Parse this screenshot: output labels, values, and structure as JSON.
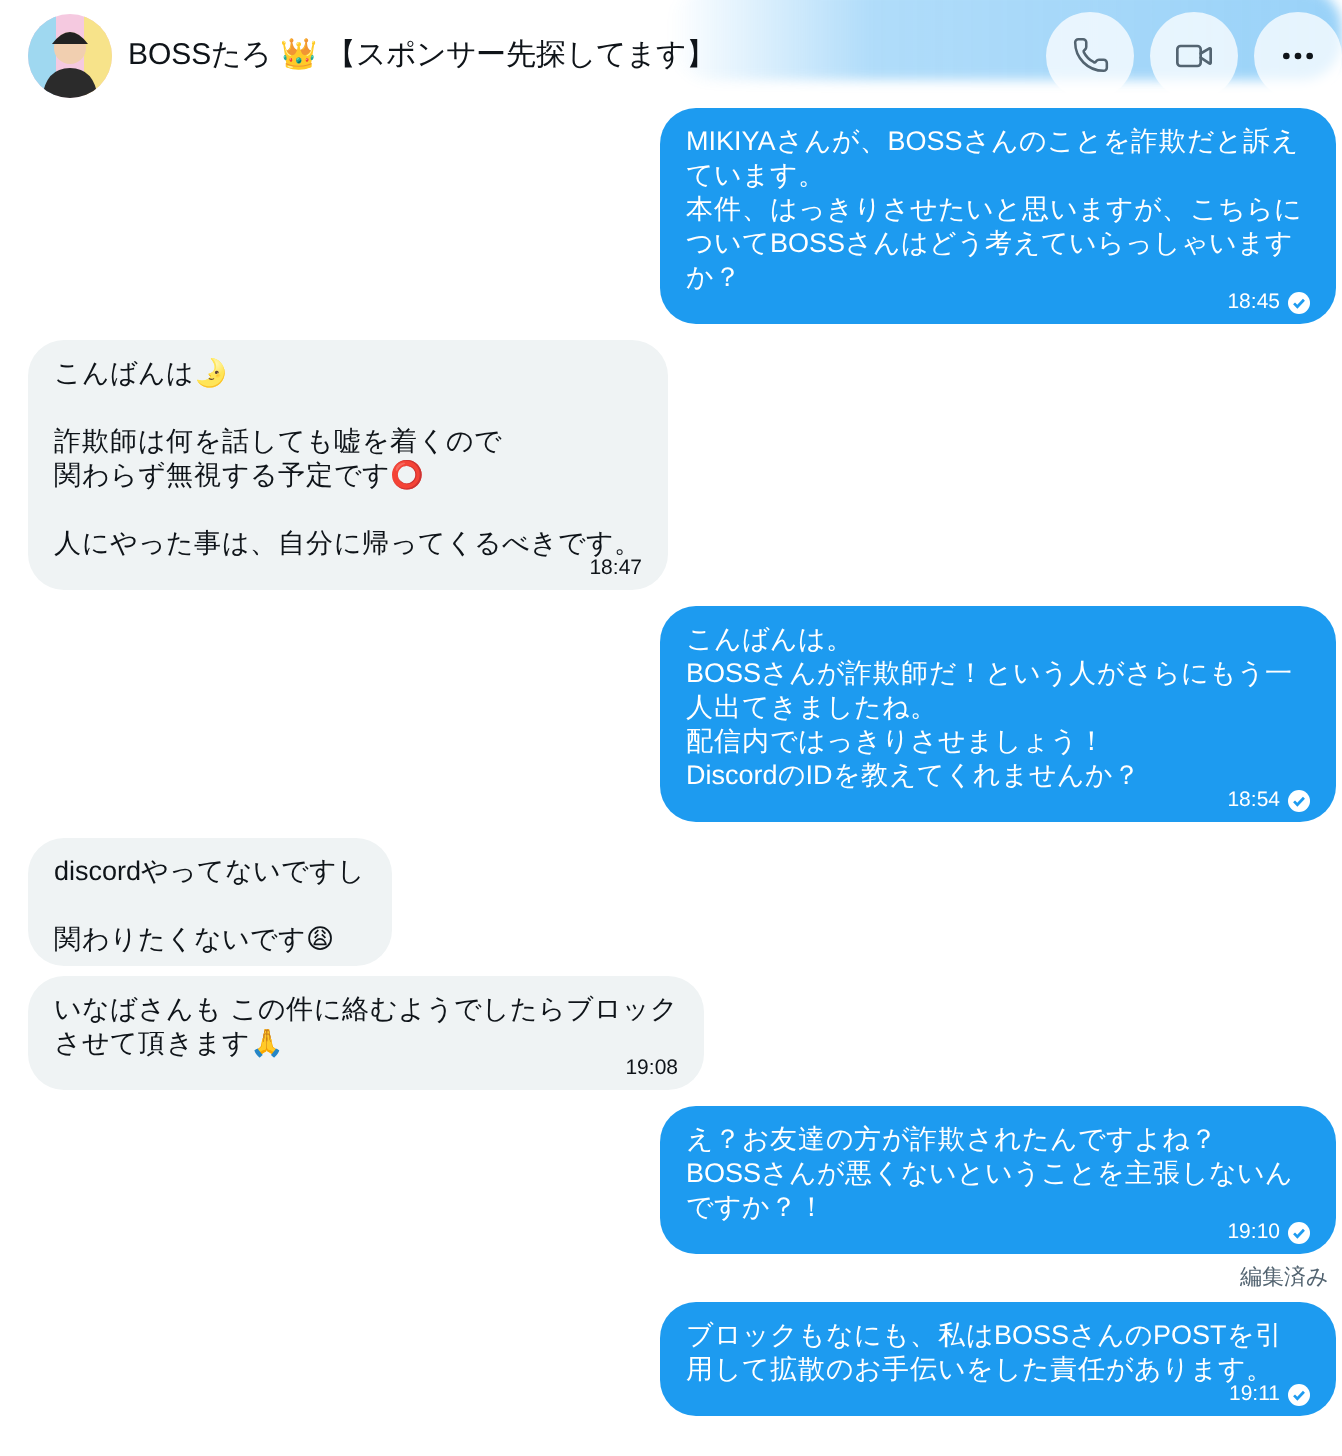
{
  "header": {
    "name": "BOSSたろ 👑 【スポンサー先探してます】"
  },
  "messages": [
    {
      "kind": "outgoing",
      "paragraphs": [
        [
          "MIKIYAさんが、BOSSさんのことを詐欺だと訴えています。",
          "本件、はっきりさせたいと思いますが、こちらについてBOSSさんはどう考えていらっしゃいますか？"
        ]
      ],
      "time": "18:45",
      "read": true,
      "edited": false
    },
    {
      "kind": "incoming",
      "paragraphs": [
        [
          "こんばんは🌛"
        ],
        [
          "詐欺師は何を話しても嘘を着くので",
          "関わらず無視する予定です⭕"
        ],
        [
          "人にやった事は、自分に帰ってくるべきです。"
        ]
      ],
      "time": "18:47"
    },
    {
      "kind": "outgoing",
      "paragraphs": [
        [
          "こんばんは。",
          "BOSSさんが詐欺師だ！という人がさらにもう一人出てきましたね。",
          "配信内ではっきりさせましょう！",
          "DiscordのIDを教えてくれませんか？"
        ]
      ],
      "time": "18:54",
      "read": true,
      "edited": false
    },
    {
      "kind": "incoming",
      "paragraphs": [
        [
          "discordやってないですし"
        ],
        [
          "関わりたくないです😩"
        ]
      ]
    },
    {
      "kind": "incoming",
      "paragraphs": [
        [
          "いなばさんも この件に絡むようでしたらブロックさせて頂きます🙏"
        ]
      ],
      "time": "19:08"
    },
    {
      "kind": "outgoing",
      "paragraphs": [
        [
          "え？お友達の方が詐欺されたんですよね？",
          "BOSSさんが悪くないということを主張しないんですか？！"
        ]
      ],
      "time": "19:10",
      "read": true,
      "edited": true,
      "edited_label": "編集済み"
    },
    {
      "kind": "outgoing",
      "paragraphs": [
        [
          "ブロックもなにも、私はBOSSさんのPOSTを引用して拡散のお手伝いをした責任があります。"
        ]
      ],
      "time": "19:11",
      "read": true,
      "edited": false
    }
  ]
}
